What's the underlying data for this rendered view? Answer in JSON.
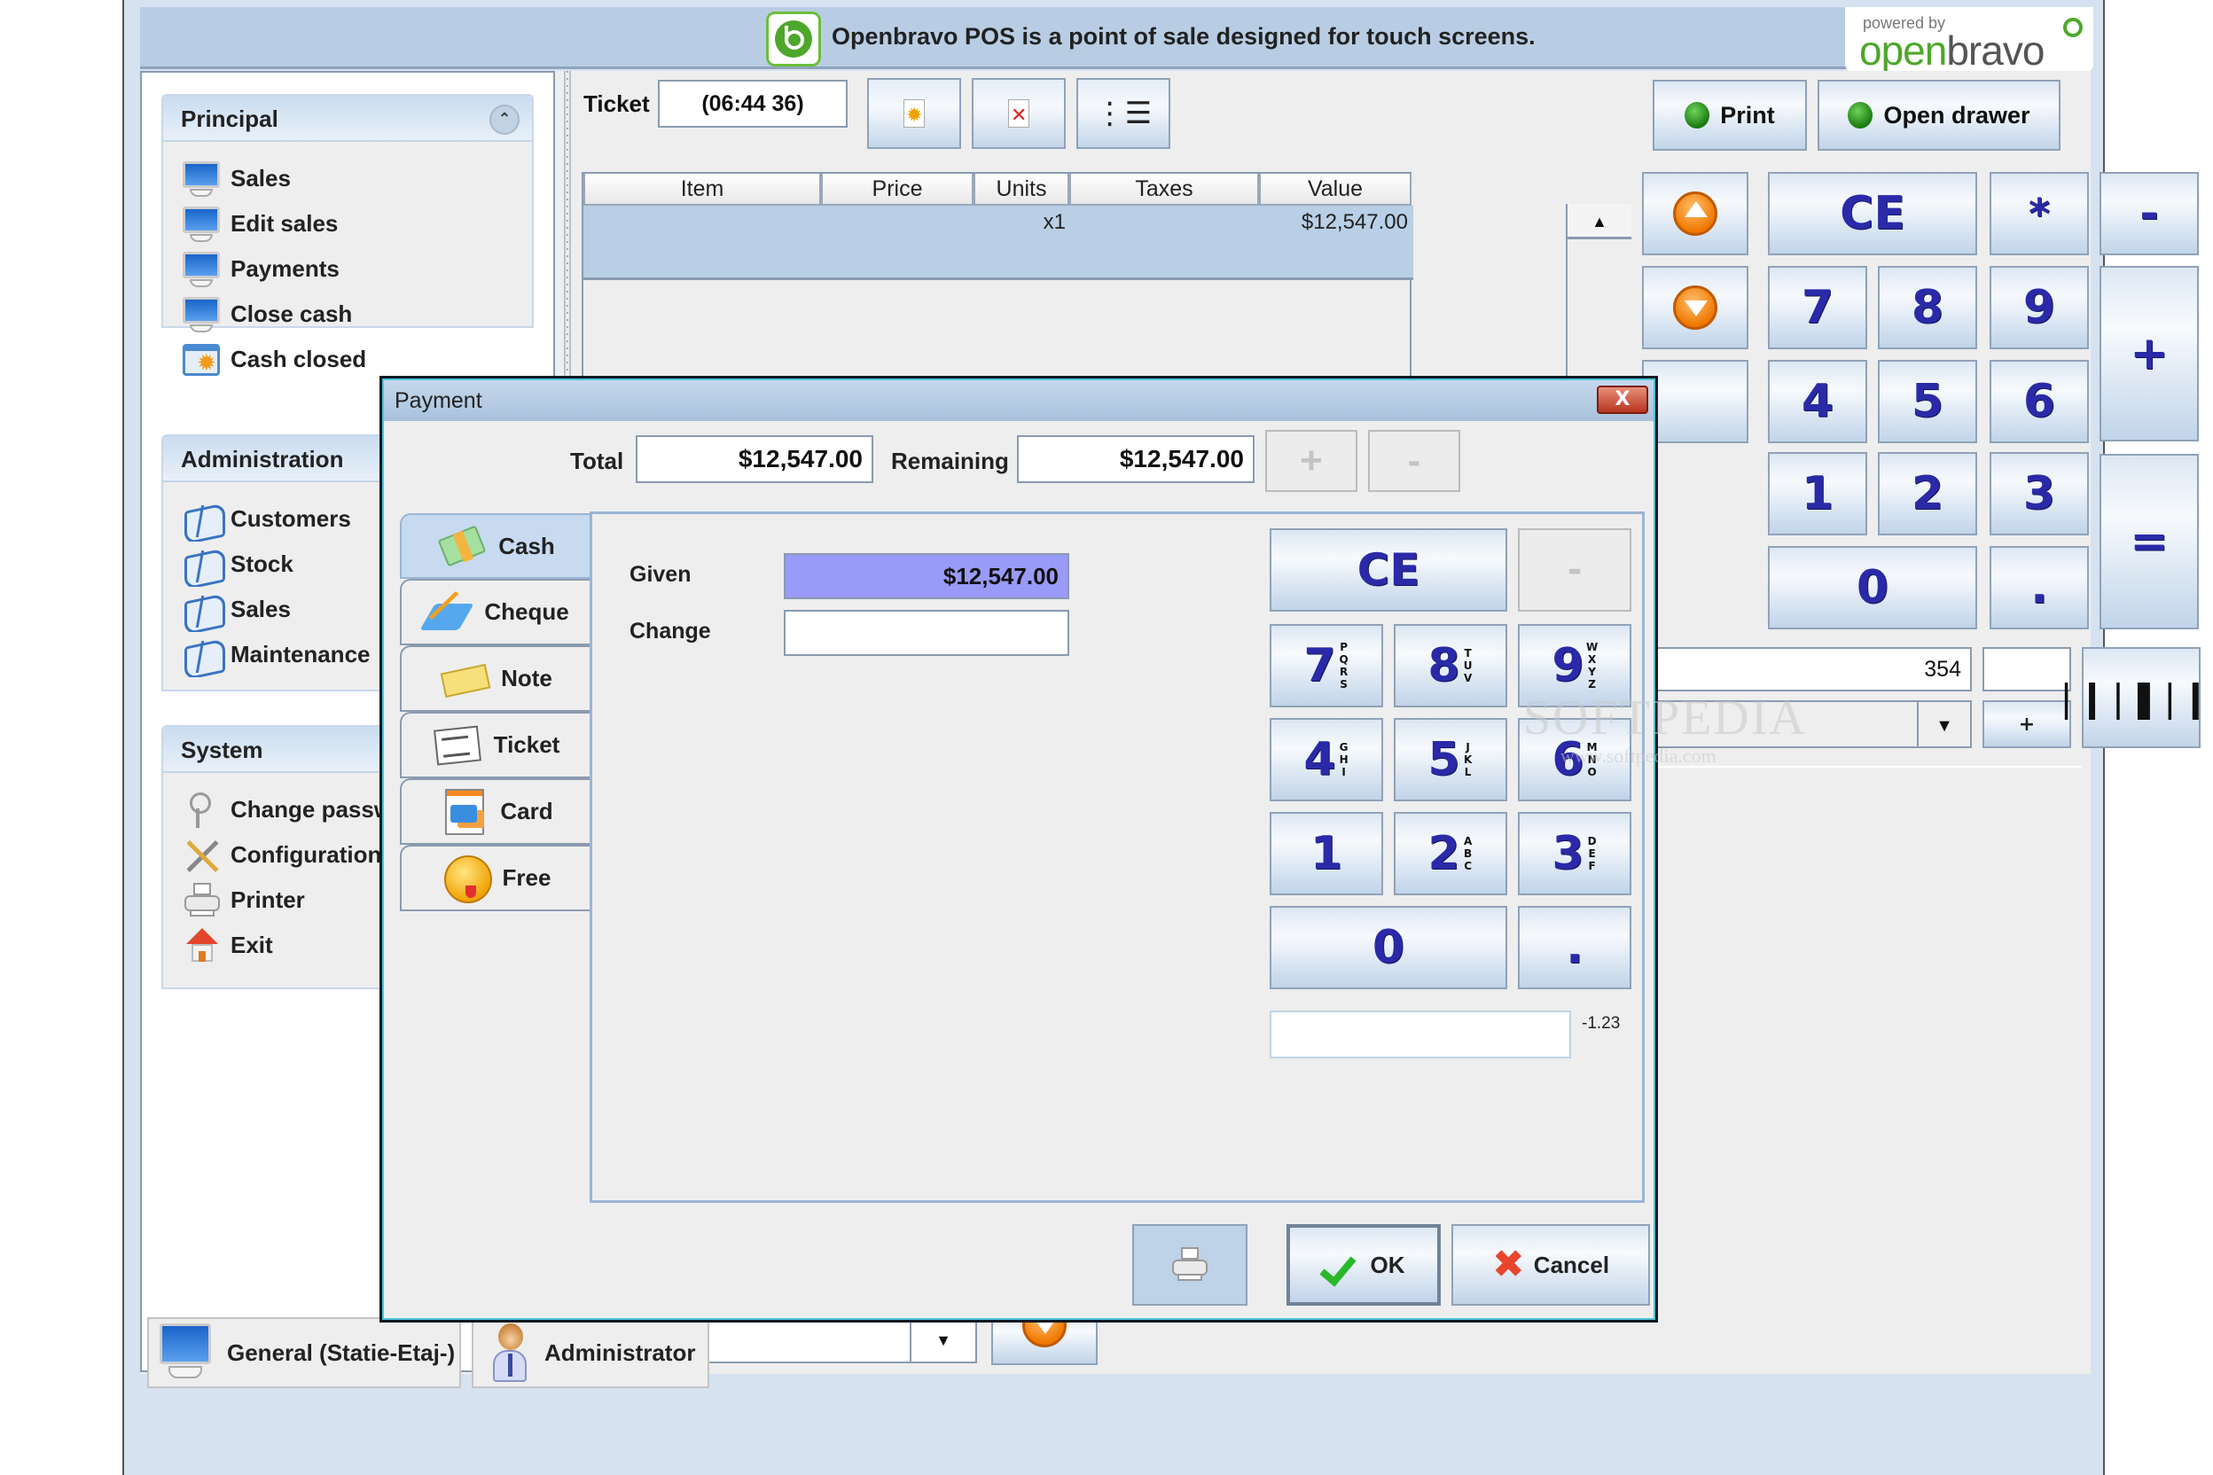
{
  "banner": {
    "message": "Openbravo POS is a point of sale designed for touch screens.",
    "powered_by": "powered by",
    "brand_open": "open",
    "brand_bravo": "bravo"
  },
  "sidebar": {
    "groups": [
      {
        "title": "Principal",
        "items": [
          {
            "label": "Sales",
            "icon": "monitor-icon"
          },
          {
            "label": "Edit sales",
            "icon": "monitor-icon"
          },
          {
            "label": "Payments",
            "icon": "monitor-icon"
          },
          {
            "label": "Close cash",
            "icon": "monitor-icon"
          },
          {
            "label": "Cash closed",
            "icon": "calendar-icon"
          }
        ]
      },
      {
        "title": "Administration",
        "items": [
          {
            "label": "Customers",
            "icon": "book-icon"
          },
          {
            "label": "Stock",
            "icon": "book-icon"
          },
          {
            "label": "Sales",
            "icon": "book-icon"
          },
          {
            "label": "Maintenance",
            "icon": "book-icon"
          }
        ]
      },
      {
        "title": "System",
        "items": [
          {
            "label": "Change password",
            "icon": "keys-icon"
          },
          {
            "label": "Configuration",
            "icon": "tools-icon"
          },
          {
            "label": "Printer",
            "icon": "printer-icon"
          },
          {
            "label": "Exit",
            "icon": "home-icon"
          }
        ]
      }
    ]
  },
  "ticket": {
    "label": "Ticket",
    "id": "(06:44 36)",
    "toolbar": [
      "new-ticket-icon",
      "delete-ticket-icon",
      "list-tickets-icon"
    ],
    "print_label": "Print",
    "open_drawer_label": "Open drawer",
    "columns": [
      "Item",
      "Price",
      "Units",
      "Taxes",
      "Value"
    ],
    "rows": [
      {
        "item": "",
        "price": "",
        "units": "x1",
        "taxes": "",
        "value": "$12,547.00"
      }
    ]
  },
  "main_keypad": {
    "ce": "CE",
    "multiply": "*",
    "minus": "-",
    "plus": "+",
    "equals": "=",
    "dot": ".",
    "digits": [
      "7",
      "8",
      "9",
      "4",
      "5",
      "6",
      "1",
      "2",
      "3",
      "0"
    ],
    "barcode_value": "354",
    "qty_value": "",
    "small_plus": "+"
  },
  "status_bar": {
    "location": "General (Statie-Etaj-)",
    "user": "Administrator"
  },
  "dialog": {
    "title": "Payment",
    "close_label": "X",
    "total_label": "Total",
    "total_value": "$12,547.00",
    "remaining_label": "Remaining",
    "remaining_value": "$12,547.00",
    "add_label": "+",
    "remove_label": "-",
    "tabs": [
      {
        "label": "Cash",
        "active": true
      },
      {
        "label": "Cheque",
        "active": false
      },
      {
        "label": "Note",
        "active": false
      },
      {
        "label": "Ticket",
        "active": false
      },
      {
        "label": "Card",
        "active": false
      },
      {
        "label": "Free",
        "active": false
      }
    ],
    "given_label": "Given",
    "given_value": "$12,547.00",
    "change_label": "Change",
    "change_value": "",
    "keypad": {
      "ce": "CE",
      "minus": "-",
      "keys": [
        {
          "digit": "7",
          "letters": "PQRS"
        },
        {
          "digit": "8",
          "letters": "TUV"
        },
        {
          "digit": "9",
          "letters": "WXYZ"
        },
        {
          "digit": "4",
          "letters": "GHI"
        },
        {
          "digit": "5",
          "letters": "JKL"
        },
        {
          "digit": "6",
          "letters": "MNO"
        },
        {
          "digit": "1",
          "letters": ""
        },
        {
          "digit": "2",
          "letters": "ABC"
        },
        {
          "digit": "3",
          "letters": "DEF"
        }
      ],
      "zero": "0",
      "dot": "."
    },
    "input_value": "",
    "input_hint": "-1.23",
    "ok_label": "OK",
    "cancel_label": "Cancel"
  },
  "watermark": {
    "text": "SOFTPEDIA",
    "url": "www.softpedia.com"
  },
  "colors": {
    "accent_blue": "#2a2aa8",
    "selected_row": "#b8cfe6",
    "given_field": "#9a9af8",
    "banner_bg": "#b8cde4",
    "led_green": "#2aa020"
  }
}
